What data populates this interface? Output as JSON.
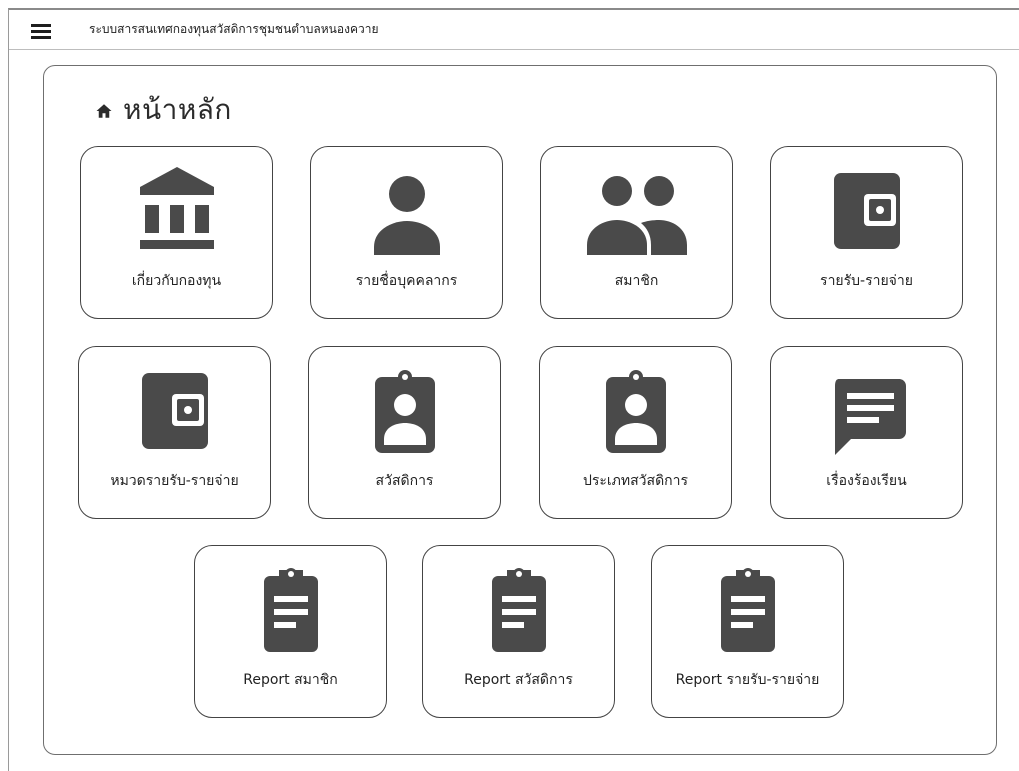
{
  "header": {
    "app_title": "ระบบสารสนเทศกองทุนสวัสดิการชุมชนตำบลหนองควาย"
  },
  "page": {
    "title": "หน้าหลัก"
  },
  "tiles": [
    {
      "label": "เกี่ยวกับกองทุน",
      "icon": "bank-icon"
    },
    {
      "label": "รายชื่อบุคคลากร",
      "icon": "person-icon"
    },
    {
      "label": "สมาชิก",
      "icon": "people-icon"
    },
    {
      "label": "รายรับ-รายจ่าย",
      "icon": "wallet-icon"
    },
    {
      "label": "หมวดรายรับ-รายจ่าย",
      "icon": "wallet-icon"
    },
    {
      "label": "สวัสดิการ",
      "icon": "badge-icon"
    },
    {
      "label": "ประเภทสวัสดิการ",
      "icon": "badge-icon"
    },
    {
      "label": "เรื่องร้องเรียน",
      "icon": "chat-icon"
    },
    {
      "label": "Report สมาชิก",
      "icon": "clipboard-icon"
    },
    {
      "label": "Report สวัสดิการ",
      "icon": "clipboard-icon"
    },
    {
      "label": "Report รายรับ-รายจ่าย",
      "icon": "clipboard-icon"
    }
  ],
  "colors": {
    "icon": "#4a4a4a",
    "border": "#444444",
    "text": "#222222"
  }
}
